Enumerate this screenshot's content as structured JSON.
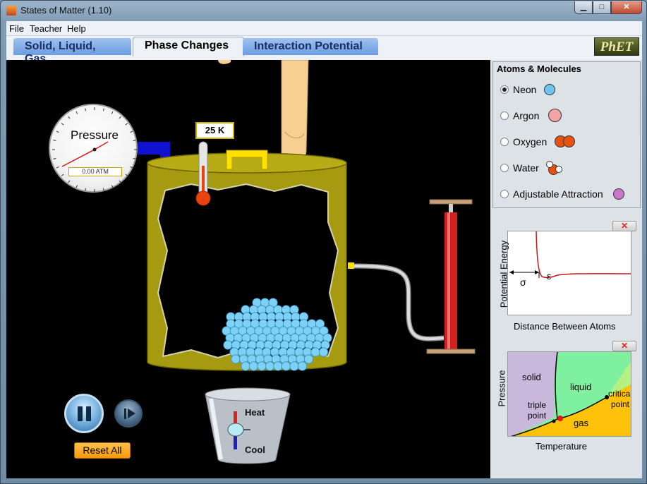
{
  "window": {
    "title": "States of Matter (1.10)",
    "minimize": "▁",
    "maximize": "□",
    "close": "✕"
  },
  "menu": [
    "File",
    "Teacher",
    "Help"
  ],
  "tabs": [
    {
      "label": "Solid, Liquid, Gas",
      "active": false
    },
    {
      "label": "Phase Changes",
      "active": true
    },
    {
      "label": "Interaction Potential",
      "active": false
    }
  ],
  "logo": "PhET",
  "pressure_gauge": {
    "title": "Pressure",
    "readout": "0.00 ATM"
  },
  "thermometer": {
    "readout": "25 K"
  },
  "heat_cool": {
    "heat_label": "Heat",
    "cool_label": "Cool"
  },
  "controls": {
    "reset_label": "Reset All"
  },
  "atoms_panel": {
    "title": "Atoms & Molecules",
    "options": [
      {
        "label": "Neon",
        "selected": true,
        "color": "#6ec4ec"
      },
      {
        "label": "Argon",
        "selected": false,
        "color": "#f4a4a4"
      },
      {
        "label": "Oxygen",
        "selected": false,
        "color": "#e85010"
      },
      {
        "label": "Water",
        "selected": false,
        "color": "#e85010"
      },
      {
        "label": "Adjustable Attraction",
        "selected": false,
        "color": "#cc77cc"
      }
    ]
  },
  "potential_graph": {
    "close": "✕",
    "ylabel": "Potential Energy",
    "xlabel": "Distance Between Atoms",
    "sigma": "σ",
    "epsilon": "ε"
  },
  "phase_diagram": {
    "close": "✕",
    "ylabel": "Pressure",
    "xlabel": "Temperature",
    "regions": {
      "solid": "solid",
      "liquid": "liquid",
      "gas": "gas",
      "triple": "triple\npoint",
      "critical": "critical\npoint"
    }
  },
  "colors": {
    "neon_particle": "#7fd0f5",
    "container": "#a59a10",
    "pump": "#d02020",
    "tab_active_bg": "#eef2f7"
  }
}
